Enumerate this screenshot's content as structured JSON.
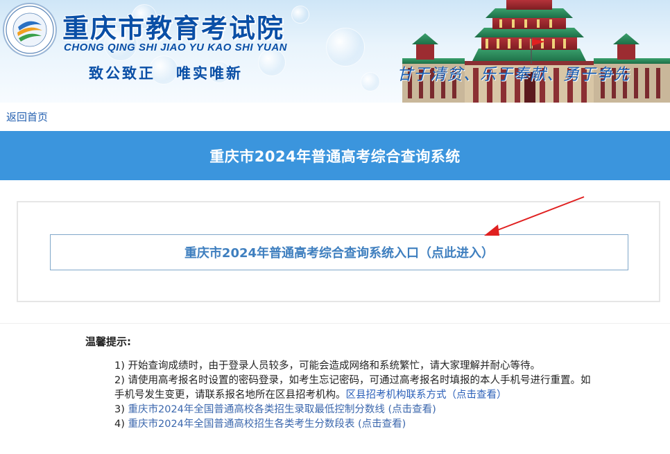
{
  "header": {
    "title_cn": "重庆市教育考试院",
    "title_pinyin": "CHONG QING SHI JIAO YU KAO SHI YUAN",
    "motto_part1": "致公致正",
    "motto_part2": "唯实唯新",
    "slogan": "甘于清贫、乐于奉献、勇于争先",
    "logo_ring_text": "Chongqing Education Examinations Authority",
    "logo_bottom_text": "重庆市教育考试院"
  },
  "nav": {
    "back_label": "返回首页"
  },
  "page": {
    "system_title": "重庆市2024年普通高考综合查询系统",
    "entry_label": "重庆市2024年普通高考综合查询系统入口（点此进入）"
  },
  "tips": {
    "title": "温馨提示:",
    "item1": "1) 开始查询成绩时，由于登录人员较多，可能会造成网络和系统繁忙，请大家理解并耐心等待。",
    "item2_text": "2) 请使用高考报名时设置的密码登录，如考生忘记密码，可通过高考报名时填报的本人手机号进行重置。如手机号发生变更，请联系报名地所在区县招考机构。",
    "item2_link": "区县招考机构联系方式（点击查看）",
    "item3_prefix": "3) ",
    "item3_link": "重庆市2024年全国普通高校各类招生录取最低控制分数线 (点击查看)",
    "item4_prefix": "4) ",
    "item4_link": "重庆市2024年全国普通高校招生各类考生分数段表 (点击查看)"
  },
  "colors": {
    "brand_blue": "#0a4fa6",
    "bar_blue": "#3b95dd",
    "entry_text": "#3f7fbf",
    "arrow_red": "#e02020",
    "link_blue": "#2a5fb8"
  }
}
